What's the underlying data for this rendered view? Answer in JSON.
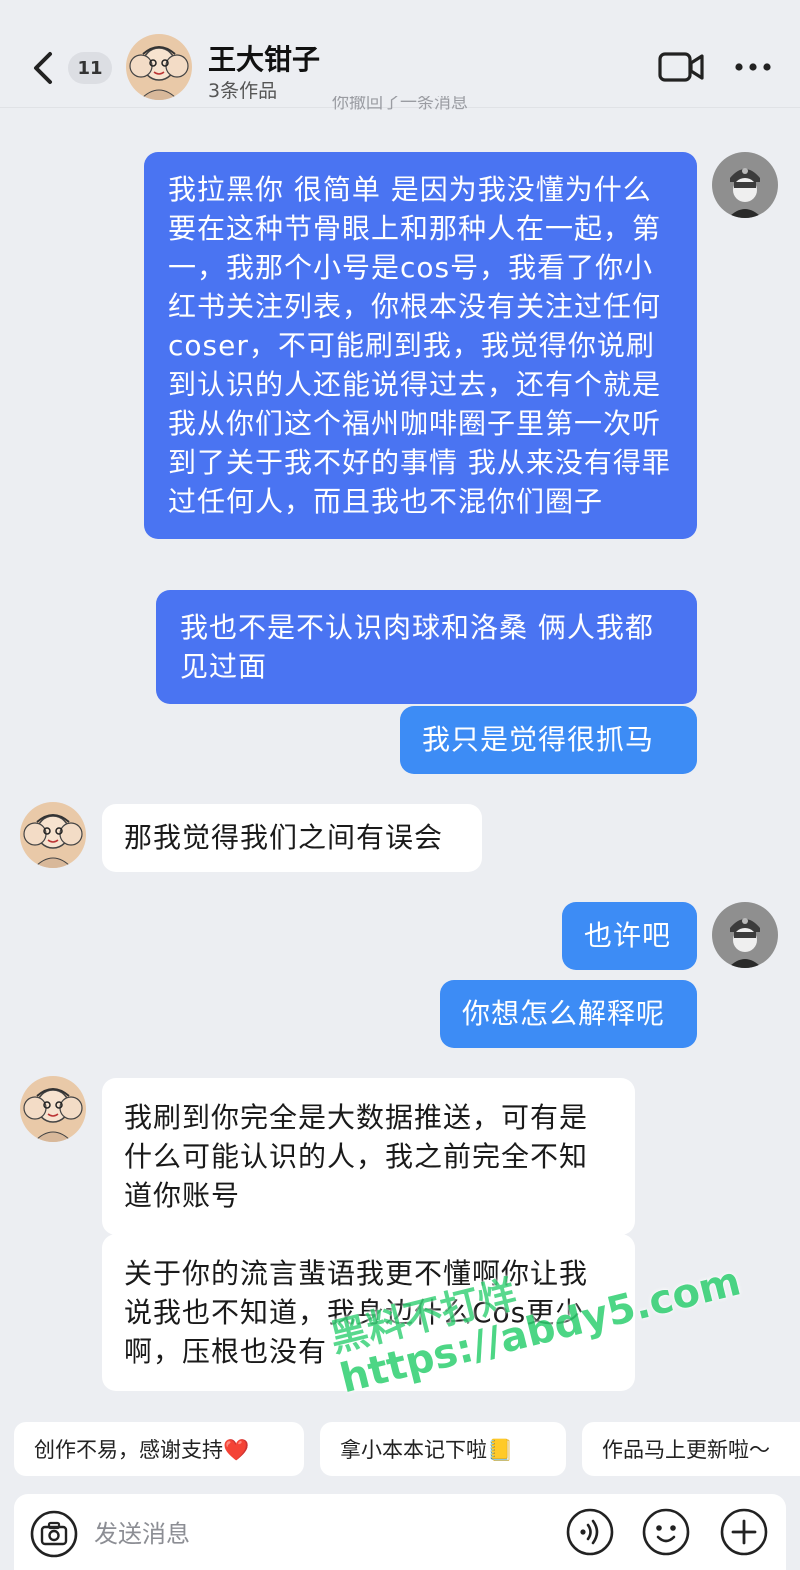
{
  "header": {
    "unread_count": "11",
    "contact_name": "王大钳子",
    "contact_sub": "3条作品",
    "system_note": "你撤回了一条消息"
  },
  "messages": [
    {
      "side": "out",
      "text": "我拉黑你 很简单 是因为我没懂为什么要在这种节骨眼上和那种人在一起，第一，我那个小号是cos号，我看了你小红书关注列表，你根本没有关注过任何coser，不可能刷到我，我觉得你说刷到认识的人还能说得过去，还有个就是我从你们这个福州咖啡圈子里第一次听到了关于我不好的事情 我从来没有得罪过任何人，而且我也不混你们圈子"
    },
    {
      "side": "out",
      "text": "我也不是不认识肉球和洛桑 俩人我都见过面"
    },
    {
      "side": "out",
      "text": "我只是觉得很抓马"
    },
    {
      "side": "in",
      "text": "那我觉得我们之间有误会"
    },
    {
      "side": "out",
      "text": "也许吧"
    },
    {
      "side": "out",
      "text": "你想怎么解释呢"
    },
    {
      "side": "in",
      "text": "我刷到你完全是大数据推送，可有是什么可能认识的人，我之前完全不知道你账号"
    },
    {
      "side": "in",
      "text": "关于你的流言蜚语我更不懂啊你让我说我也不知道，我身边什么Cos更少啊，压根也没有"
    }
  ],
  "watermark": {
    "line1": "黑料不打烊",
    "line2": "https://abdy5.com"
  },
  "quick_replies": [
    "创作不易，感谢支持❤️",
    "拿小本本记下啦📒",
    "作品马上更新啦～"
  ],
  "input": {
    "placeholder": "发送消息"
  },
  "colors": {
    "outgoing_bubble": "#4a74f2",
    "incoming_bubble": "#ffffff",
    "background": "#eceef2"
  }
}
